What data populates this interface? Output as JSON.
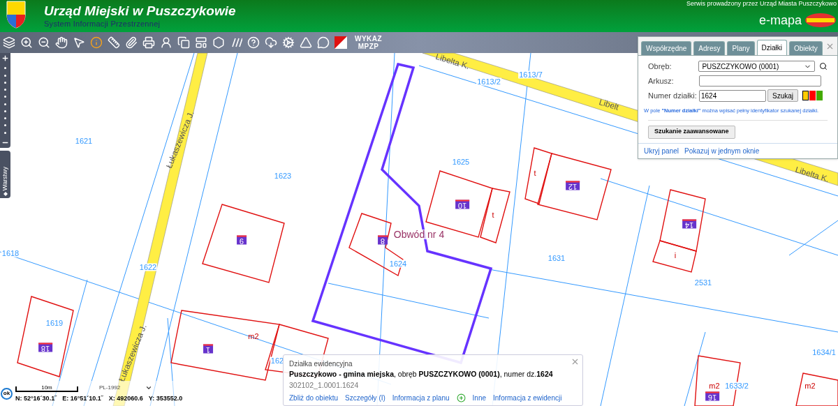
{
  "header": {
    "title": "Urząd Miejski w Puszczykowie",
    "subtitle": "System Informacji Przestrzennej",
    "service_note": "Serwis prowadzony przez Urząd Miasta Puszczykowo",
    "brand": "e-mapa"
  },
  "toolbar": {
    "list_button": [
      "WYKAZ",
      "MPZP"
    ]
  },
  "layers_tab": {
    "label": "Warstwy"
  },
  "map": {
    "labels": [
      {
        "text": "1621",
        "kind": "parcel"
      },
      {
        "text": "1623",
        "kind": "parcel"
      },
      {
        "text": "1625",
        "kind": "parcel"
      },
      {
        "text": "1613/2",
        "kind": "parcel"
      },
      {
        "text": "1613/7",
        "kind": "parcel"
      },
      {
        "text": "1618",
        "kind": "parcel"
      },
      {
        "text": "1622",
        "kind": "parcel"
      },
      {
        "text": "1624",
        "kind": "parcel"
      },
      {
        "text": "1631",
        "kind": "parcel"
      },
      {
        "text": "2531",
        "kind": "parcel"
      },
      {
        "text": "1619",
        "kind": "parcel"
      },
      {
        "text": "162",
        "kind": "parcel"
      },
      {
        "text": "1634/1",
        "kind": "parcel"
      },
      {
        "text": "1633/2",
        "kind": "parcel"
      },
      {
        "text": "Obwód nr 4",
        "kind": "district"
      },
      {
        "text": "Łukaszewicza J.",
        "kind": "street"
      },
      {
        "text": "Łukaszewicza J.",
        "kind": "street"
      },
      {
        "text": "Libelta K.",
        "kind": "street"
      },
      {
        "text": "Libelt",
        "kind": "street"
      },
      {
        "text": "Libelta K.",
        "kind": "street"
      },
      {
        "text": "9",
        "kind": "building"
      },
      {
        "text": "8",
        "kind": "building"
      },
      {
        "text": "10",
        "kind": "building"
      },
      {
        "text": "12",
        "kind": "building"
      },
      {
        "text": "14",
        "kind": "building"
      },
      {
        "text": "18",
        "kind": "building"
      },
      {
        "text": "1",
        "kind": "building"
      },
      {
        "text": "16",
        "kind": "building"
      },
      {
        "text": "t",
        "kind": "use"
      },
      {
        "text": "t",
        "kind": "use"
      },
      {
        "text": "i",
        "kind": "use"
      },
      {
        "text": "m2",
        "kind": "use"
      },
      {
        "text": "m2",
        "kind": "use"
      },
      {
        "text": "m2",
        "kind": "use"
      }
    ]
  },
  "panel": {
    "tabs": [
      {
        "label": "Współrzędne",
        "selected": false
      },
      {
        "label": "Adresy",
        "selected": false
      },
      {
        "label": "Plany",
        "selected": false
      },
      {
        "label": "Działki",
        "selected": true
      },
      {
        "label": "Obiekty",
        "selected": false
      }
    ],
    "precinct": {
      "label": "Obręb:",
      "value": "PUSZCZYKOWO (0001)"
    },
    "sheet": {
      "label": "Arkusz:"
    },
    "parcel_number": {
      "label": "Numer działki:",
      "value": "1624"
    },
    "search_button": "Szukaj",
    "colors": [
      {
        "color": "#ffcc00",
        "selected": true
      },
      {
        "color": "#ff0000",
        "selected": false
      },
      {
        "color": "#44aa00",
        "selected": false
      }
    ],
    "hint": "W pole **\"Numer działki\"** można wpisać pełny identyfikator szukanej działki.",
    "advanced_button": "Szukanie zaawansowane",
    "links": [
      "Ukryj panel",
      "Pokazuj w jednym oknie"
    ]
  },
  "popup": {
    "title": "Działka ewidencyjna",
    "description": "**Puszczykowo - gmina miejska**, obręb **PUSZCZYKOWO (0001)**, numer dz.**1624**",
    "identifier": "302102_1.0001.1624",
    "links": [
      {
        "label": "Zbliż do obiektu",
        "kind": "link"
      },
      {
        "label": "Szczegóły (I)",
        "kind": "link"
      },
      {
        "label": "Informacja z planu",
        "kind": "link"
      },
      {
        "label": "Inne",
        "kind": "more"
      },
      {
        "label": "Informacja z ewidencji",
        "kind": "link"
      }
    ]
  },
  "status_bar": {
    "ok_button": "ok",
    "scale": "10m",
    "projection": "PL-1992",
    "coords": [
      "N: 52°16´30.1˝",
      "E: 16°51´10.1˝",
      "X: 492060.6",
      "Y: 353552.0"
    ]
  }
}
